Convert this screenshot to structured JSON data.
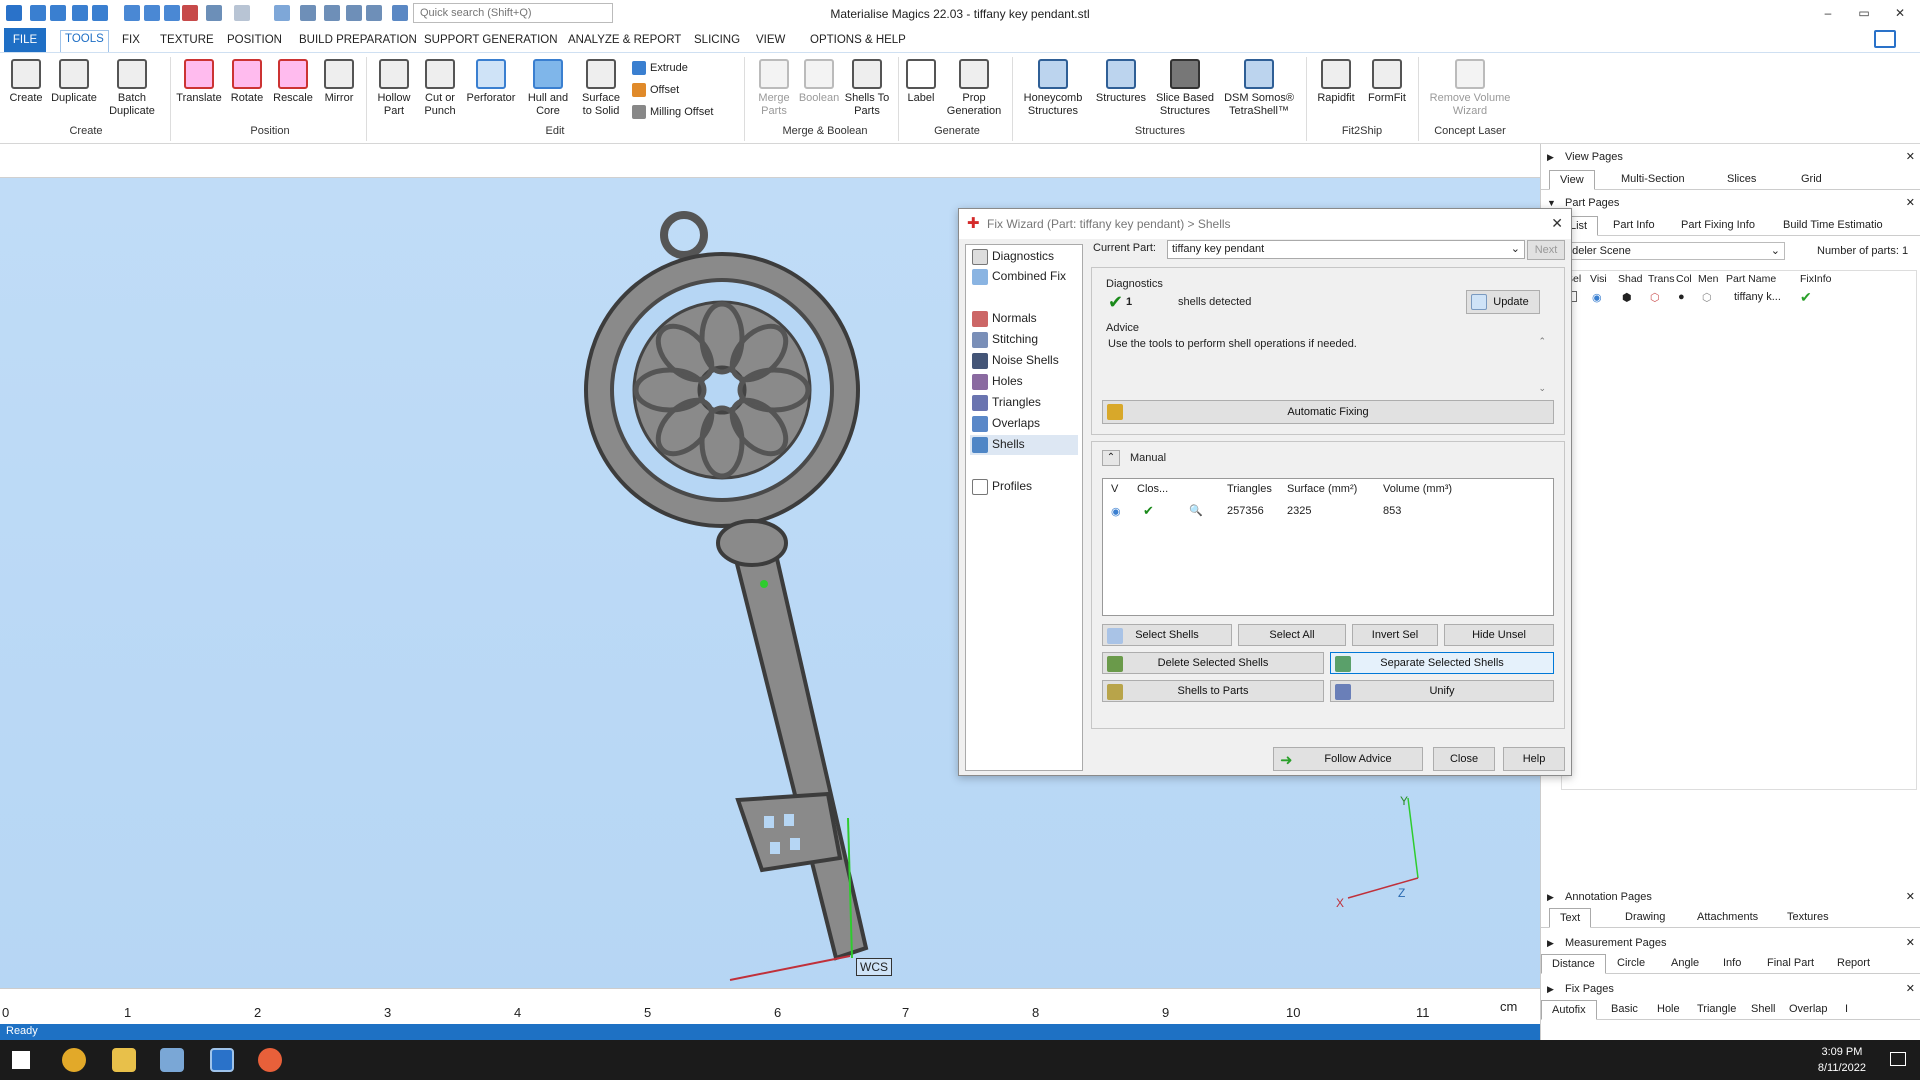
{
  "window": {
    "title": "Materialise Magics 22.03 - tiffany key pendant.stl",
    "quick_search_placeholder": "Quick search (Shift+Q)",
    "controls": [
      "–",
      "▭",
      "✕"
    ]
  },
  "menu": {
    "tabs": [
      "FILE",
      "TOOLS",
      "FIX",
      "TEXTURE",
      "POSITION",
      "BUILD PREPARATION",
      "SUPPORT GENERATION",
      "ANALYZE & REPORT",
      "SLICING",
      "VIEW",
      "OPTIONS & HELP"
    ],
    "active": "TOOLS"
  },
  "ribbon": {
    "create": [
      "Create",
      "Duplicate",
      "Batch Duplicate"
    ],
    "position": [
      "Translate",
      "Rotate",
      "Rescale",
      "Mirror"
    ],
    "edit": [
      "Hollow Part",
      "Cut or Punch",
      "Perforator",
      "Hull and Core",
      "Surface to Solid"
    ],
    "edit_small": [
      "Extrude",
      "Offset",
      "Milling Offset"
    ],
    "merge": [
      "Merge Parts",
      "Boolean",
      "Shells To Parts"
    ],
    "generate": [
      "Label",
      "Prop Generation"
    ],
    "structures": [
      "Honeycomb Structures",
      "Structures",
      "Slice Based Structures",
      "DSM Somos® TetraShell™"
    ],
    "fit2ship": [
      "Rapidfit",
      "FormFit"
    ],
    "concept": [
      "Remove Volume Wizard"
    ],
    "groups": [
      "Create",
      "Position",
      "Edit",
      "Merge & Boolean",
      "Generate",
      "Structures",
      "Fit2Ship",
      "Concept Laser"
    ]
  },
  "viewport": {
    "wcs_label": "WCS",
    "axis_y": "Y",
    "axis_x": "X",
    "axis_z": "Z",
    "ruler": [
      "0",
      "1",
      "2",
      "3",
      "4",
      "5",
      "6",
      "7",
      "8",
      "9",
      "10",
      "11"
    ],
    "ruler_unit": "cm"
  },
  "status": {
    "text": "Ready"
  },
  "right_panel": {
    "view_pages": "View Pages",
    "view_tabs": [
      "View",
      "Multi-Section",
      "Slices",
      "Grid"
    ],
    "part_pages": "Part Pages",
    "part_tabs": [
      "List",
      "Part Info",
      "Part Fixing Info",
      "Build Time Estimatio"
    ],
    "scene": "odeler Scene",
    "num_parts_label": "Number of parts:",
    "num_parts": "1",
    "columns": [
      "Sel",
      "Visi",
      "Shad",
      "Trans",
      "Col",
      "Men",
      "Part Name",
      "FixInfo"
    ],
    "row_name": "tiffany k...",
    "annotation_pages": "Annotation Pages",
    "annotation_tabs": [
      "Text",
      "Drawing",
      "Attachments",
      "Textures"
    ],
    "measurement_pages": "Measurement Pages",
    "measurement_tabs": [
      "Distance",
      "Circle",
      "Angle",
      "Info",
      "Final Part",
      "Report"
    ],
    "fix_pages": "Fix Pages",
    "fix_tabs": [
      "Autofix",
      "Basic",
      "Hole",
      "Triangle",
      "Shell",
      "Overlap",
      "I"
    ]
  },
  "dialog": {
    "title": "Fix Wizard (Part: tiffany key pendant) > Shells",
    "nav": [
      "Diagnostics",
      "Combined Fix",
      "Normals",
      "Stitching",
      "Noise Shells",
      "Holes",
      "Triangles",
      "Overlaps",
      "Shells",
      "Profiles"
    ],
    "current_part_label": "Current Part:",
    "current_part": "tiffany key pendant",
    "next": "Next",
    "diagnostics_label": "Diagnostics",
    "shell_count": "1",
    "shells_detected": "shells detected",
    "update": "Update",
    "advice_label": "Advice",
    "advice_text": "Use the tools to perform shell operations if needed.",
    "automatic_fixing": "Automatic Fixing",
    "manual_label": "Manual",
    "table_headers": [
      "V",
      "Clos...",
      "",
      "Triangles",
      "Surface (mm²)",
      "Volume (mm³)"
    ],
    "table_row": {
      "triangles": "257356",
      "surface": "2325",
      "volume": "853"
    },
    "buttons": {
      "select_shells": "Select Shells",
      "select_all": "Select All",
      "invert_sel": "Invert Sel",
      "hide_unsel": "Hide Unsel",
      "delete_selected": "Delete Selected Shells",
      "separate_selected": "Separate Selected Shells",
      "shells_to_parts": "Shells to Parts",
      "unify": "Unify",
      "follow_advice": "Follow Advice",
      "close": "Close",
      "help": "Help"
    }
  },
  "taskbar": {
    "time": "3:09 PM",
    "date": "8/11/2022"
  }
}
